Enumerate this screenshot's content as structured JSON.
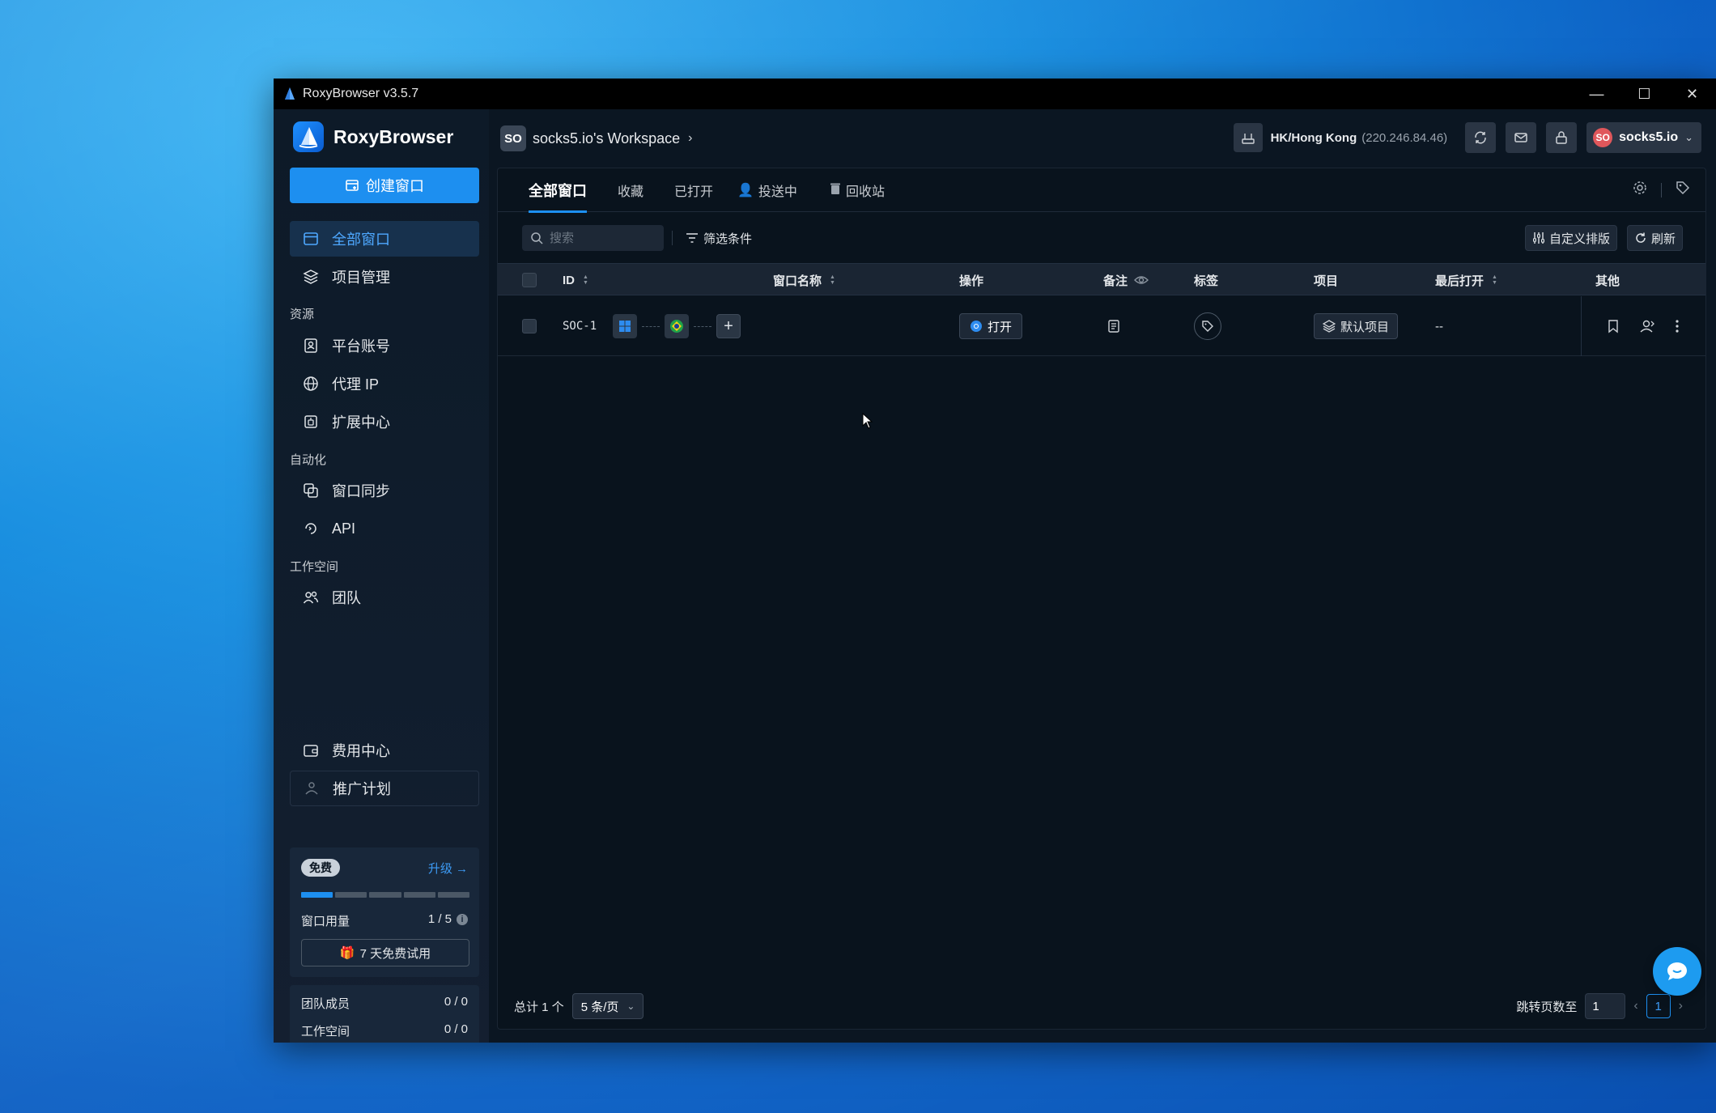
{
  "window": {
    "title": "RoxyBrowser v3.5.7",
    "controls": [
      "minimize",
      "maximize",
      "close"
    ]
  },
  "sidebar": {
    "brand": "RoxyBrowser",
    "create_button": "创建窗口",
    "items_top": [
      {
        "label": "全部窗口",
        "icon": "window-icon",
        "active": true
      },
      {
        "label": "项目管理",
        "icon": "layers-icon",
        "active": false
      }
    ],
    "section_resources": "资源",
    "items_resources": [
      {
        "label": "平台账号",
        "icon": "account-icon"
      },
      {
        "label": "代理 IP",
        "icon": "globe-icon"
      },
      {
        "label": "扩展中心",
        "icon": "extension-icon"
      }
    ],
    "section_automation": "自动化",
    "items_automation": [
      {
        "label": "窗口同步",
        "icon": "sync-window-icon"
      },
      {
        "label": "API",
        "icon": "api-icon"
      }
    ],
    "section_workspace": "工作空间",
    "items_workspace": [
      {
        "label": "团队",
        "icon": "team-icon"
      }
    ],
    "items_bottom": [
      {
        "label": "费用中心",
        "icon": "wallet-icon"
      },
      {
        "label": "推广计划",
        "icon": "promotion-icon"
      }
    ],
    "plan": {
      "badge": "免费",
      "upgrade": "升级 →",
      "usage_label": "窗口用量",
      "usage_value": "1 / 5",
      "usage_fraction": 0.2,
      "trial_button": "7 天免费试用"
    },
    "team": {
      "members_label": "团队成员",
      "members_value": "0 / 0",
      "workspaces_label": "工作空间",
      "workspaces_value": "0 / 0"
    }
  },
  "header": {
    "workspace_avatar": "SO",
    "workspace_name": "socks5.io's Workspace",
    "proxy_location": "HK/Hong Kong",
    "proxy_ip": "(220.246.84.46)",
    "user_avatar": "SO",
    "user_name": "socks5.io"
  },
  "tabs": [
    {
      "label": "全部窗口",
      "active": true
    },
    {
      "label": "收藏"
    },
    {
      "label": "已打开"
    },
    {
      "label": "投送中"
    },
    {
      "label": "回收站"
    }
  ],
  "toolbar": {
    "search_placeholder": "搜索",
    "filter_label": "筛选条件",
    "custom_sort": "自定义排版",
    "refresh": "刷新"
  },
  "table": {
    "columns": [
      "ID",
      "窗口名称",
      "操作",
      "备注",
      "标签",
      "项目",
      "最后打开",
      "其他"
    ],
    "rows": [
      {
        "id": "SOC-1",
        "os": "windows",
        "flag": "brazil",
        "action": "打开",
        "project": "默认项目",
        "last_opened": "--"
      }
    ]
  },
  "footer": {
    "total": "总计 1 个",
    "page_size": "5 条/页",
    "jump_label": "跳转页数至",
    "jump_value": "1",
    "current_page": "1"
  },
  "colors": {
    "accent": "#1d8ff0",
    "panel": "#09131d",
    "sidebar": "#0d1a28"
  }
}
